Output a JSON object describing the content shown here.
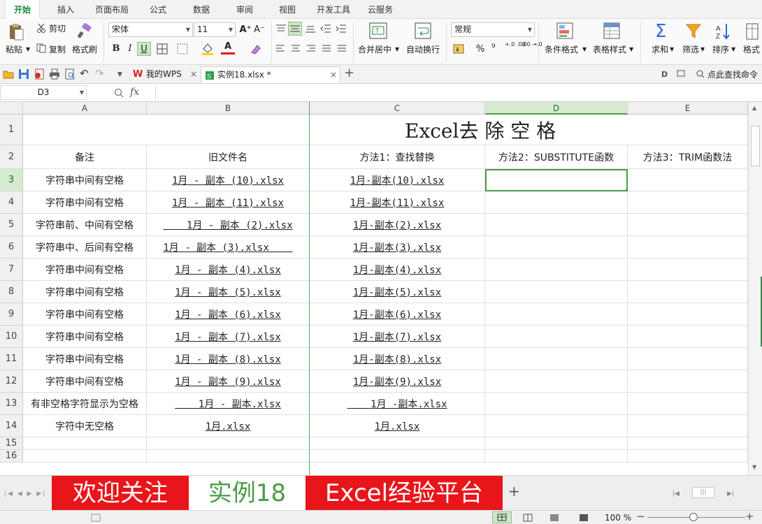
{
  "menubar": {
    "tabs": [
      "开始",
      "插入",
      "页面布局",
      "公式",
      "数据",
      "审阅",
      "视图",
      "开发工具",
      "云服务"
    ]
  },
  "ribbon": {
    "paste": "粘贴",
    "cut": "剪切",
    "copy": "复制",
    "format_painter": "格式刷",
    "font_name": "宋体",
    "font_size": "11",
    "bold": "B",
    "italic": "I",
    "underline": "U",
    "merge_center": "合并居中",
    "wrap_text": "自动换行",
    "number_format": "常规",
    "percent": "%",
    "thousands": "⁹",
    "dec_increase": "+.0 .00",
    "dec_decrease": ".00 →.0",
    "conditional_format": "条件格式",
    "table_style": "表格样式",
    "sum": "求和",
    "filter": "筛选",
    "sort": "排序",
    "format": "格式"
  },
  "quickbar": {
    "wps_tab": "我的WPS",
    "file_tab": "实例18.xlsx *",
    "search_cmd": "点此查找命令"
  },
  "formula_bar": {
    "name_box": "D3",
    "fx": "fx",
    "formula": ""
  },
  "sheet": {
    "columns": [
      "A",
      "B",
      "C",
      "D",
      "E"
    ],
    "rows": [
      "1",
      "2",
      "3",
      "4",
      "5",
      "6",
      "7",
      "8",
      "9",
      "10",
      "11",
      "12",
      "13",
      "14",
      "15",
      "16"
    ],
    "title": "Excel去 除 空 格",
    "headers": [
      "备注",
      "旧文件名",
      "方法1：查找替换",
      "方法2：SUBSTITUTE函数",
      "方法3：TRIM函数法"
    ],
    "data": [
      {
        "a": "字符串中间有空格",
        "b": "1月 - 副本 (10).xlsx",
        "c": "1月-副本(10).xlsx"
      },
      {
        "a": "字符串中间有空格",
        "b": "1月 - 副本 (11).xlsx",
        "c": "1月-副本(11).xlsx"
      },
      {
        "a": "字符串前、中间有空格",
        "b": "    1月 - 副本 (2).xlsx",
        "c": "1月-副本(2).xlsx"
      },
      {
        "a": "字符串中、后间有空格",
        "b": "1月 - 副本 (3).xlsx    ",
        "c": "1月-副本(3).xlsx"
      },
      {
        "a": "字符串中间有空格",
        "b": "1月 - 副本 (4).xlsx",
        "c": "1月-副本(4).xlsx"
      },
      {
        "a": "字符串中间有空格",
        "b": "1月 - 副本 (5).xlsx",
        "c": "1月-副本(5).xlsx"
      },
      {
        "a": "字符串中间有空格",
        "b": "1月 - 副本 (6).xlsx",
        "c": "1月-副本(6).xlsx"
      },
      {
        "a": "字符串中间有空格",
        "b": "1月 - 副本 (7).xlsx",
        "c": "1月-副本(7).xlsx"
      },
      {
        "a": "字符串中间有空格",
        "b": "1月 - 副本 (8).xlsx",
        "c": "1月-副本(8).xlsx"
      },
      {
        "a": "字符串中间有空格",
        "b": "1月 - 副本 (9).xlsx",
        "c": "1月-副本(9).xlsx"
      },
      {
        "a": "有非空格字符显示为空格",
        "b": "    1月 - 副本.xlsx",
        "c": "    1月 -副本.xlsx"
      },
      {
        "a": "字符中无空格",
        "b": "1月.xlsx",
        "c": "1月.xlsx"
      }
    ]
  },
  "sheet_tabs": {
    "tab1": "欢迎关注",
    "tab2": "实例18",
    "tab3": "Excel经验平台"
  },
  "status": {
    "zoom": "100 %"
  },
  "colors": {
    "accent_green": "#1e8a3c",
    "tab_red": "#e8151b",
    "selection_green": "#4c9a48"
  }
}
